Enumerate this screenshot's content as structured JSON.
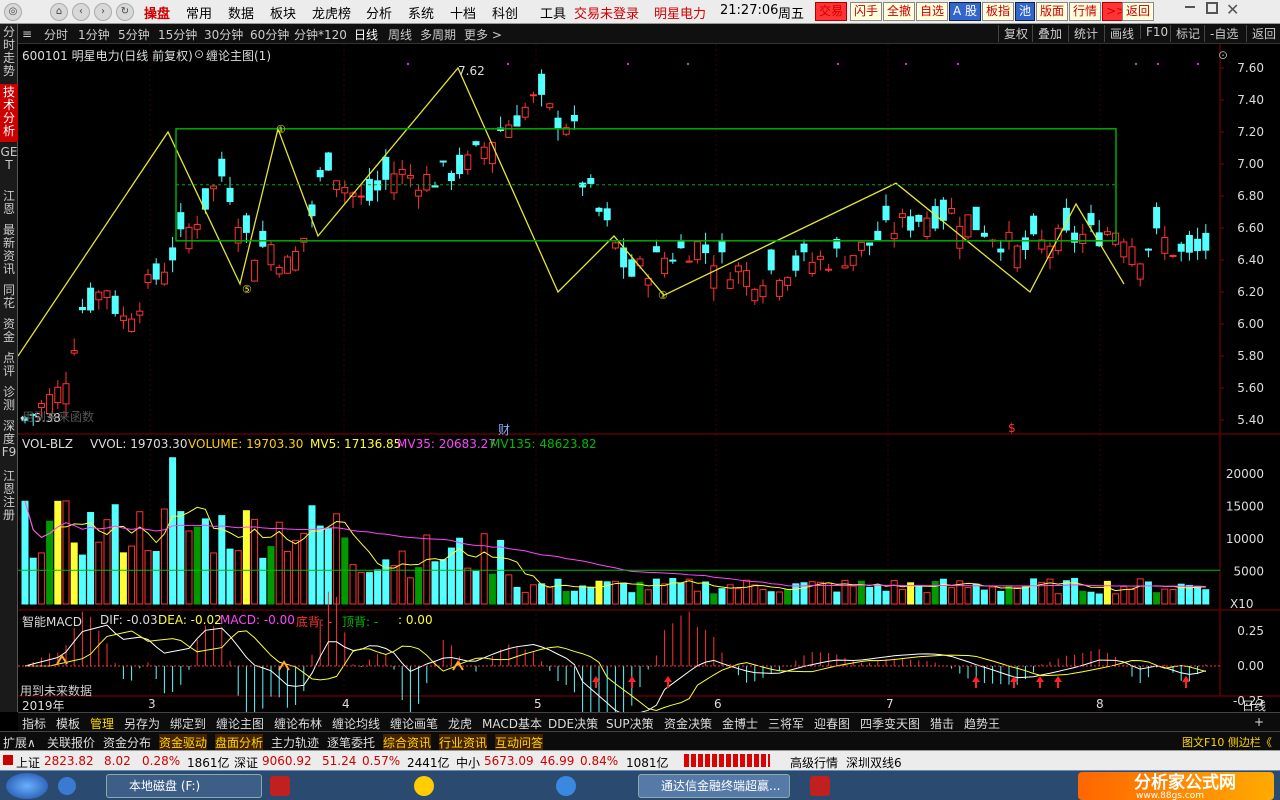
{
  "menu": {
    "brand": "操盘",
    "items": [
      "常用",
      "数据",
      "板块",
      "龙虎榜",
      "分析",
      "系统",
      "十档",
      "科创",
      "工具"
    ],
    "trade_status": "交易未登录",
    "stock_name": "明星电力",
    "time": "21:27:06",
    "weekday": "周五",
    "right_buttons": [
      "交易",
      "闪手",
      "全撤",
      "自选",
      "A 股",
      "板指",
      "池",
      "版面",
      "行情",
      ">>",
      "返回"
    ]
  },
  "side_tabs": [
    "分时走势",
    "技术分析",
    "GET",
    "江恩",
    "最新资讯",
    "同花",
    "资金",
    "点评",
    "诊测",
    "深度F9",
    "江恩注册"
  ],
  "periods": [
    "分时",
    "1分钟",
    "5分钟",
    "15分钟",
    "30分钟",
    "60分钟",
    "分钟*120",
    "日线",
    "周线",
    "多周期",
    "更多 >"
  ],
  "active_period": "日线",
  "right_tools": [
    "复权",
    "叠加",
    "统计",
    "画线",
    "F10",
    "标记",
    "-自选",
    "返回"
  ],
  "main_panel": {
    "title": "600101 明星电力(日线 前复权)",
    "indicator": "缠论主图(1)",
    "high_label": "7.62",
    "low_label": "5.38",
    "hidden_text": "用到未来函数",
    "cai_mark": "财",
    "s_mark": "$",
    "price_ticks": [
      "7.60",
      "7.40",
      "7.20",
      "7.00",
      "6.80",
      "6.60",
      "6.40",
      "6.20",
      "6.00",
      "5.80",
      "5.60",
      "5.40"
    ],
    "pivot_labels": [
      "①",
      "⑤",
      "①"
    ]
  },
  "volume_panel": {
    "label": "VOL-BLZ",
    "vvol": "VVOL: 19703.30",
    "volume": "VOLUME: 19703.30",
    "mv5": "MV5: 17136.85",
    "mv35": "MV35: 20683.27",
    "mv135": "MV135: 48623.82",
    "ticks": [
      "20000",
      "15000",
      "10000",
      "5000"
    ],
    "unit": "X10"
  },
  "macd_panel": {
    "name": "智能MACD",
    "dif": "DIF: -0.03",
    "dea": "DEA: -0.02",
    "macd": "MACD: -0.00",
    "bottom_div": "底背: -",
    "top_div": "顶背: -",
    "value": ": 0.00",
    "ticks": [
      "0.25",
      "0.00",
      "-0.25"
    ],
    "future_note": "用到未来数据"
  },
  "x_axis": {
    "labels": [
      "2019年",
      "3",
      "4",
      "5",
      "6",
      "7",
      "8"
    ],
    "corner": "日线"
  },
  "tab_row1": [
    "指标",
    "模板",
    "管理",
    "另存为",
    "绑定到",
    "缠论主图",
    "缠论布林",
    "缠论均线",
    "缠论画笔",
    "龙虎",
    "MACD基本",
    "DDE决策",
    "SUP决策",
    "资金决策",
    "金博士",
    "三将军",
    "迎春图",
    "四季变天图",
    "猎击",
    "趋势王"
  ],
  "tab_row1_active": "管理",
  "tab_row2": [
    "扩展∧",
    "关联报价",
    "资金分布",
    "资金驱动",
    "盘面分析",
    "主力轨迹",
    "逐笔委托",
    "综合资讯",
    "行业资讯",
    "互动问答"
  ],
  "tab_row2_right": "图文F10 侧边栏《",
  "status": {
    "sh_label": "上证",
    "sh_value": "2823.82",
    "sh_change": "8.02",
    "sh_pct": "0.28%",
    "sh_amount": "1861亿",
    "sz_label": "深证",
    "sz_value": "9060.92",
    "sz_change": "51.24",
    "sz_pct": "0.57%",
    "sz_amount": "2441亿",
    "zx_label": "中小",
    "zx_value": "5673.09",
    "zx_change": "46.99",
    "zx_pct": "0.84%",
    "zx_amount": "1081亿",
    "feed": "高级行情",
    "line": "深圳双线6"
  },
  "taskbar": {
    "disk": "本地磁盘 (F:)",
    "app": "通达信金融终端超赢...",
    "watermark": "分析家公式网",
    "watermark_url": "www.88gs.com"
  },
  "colors": {
    "up": "#ff3333",
    "down": "#54ffff",
    "yellow_bar": "#ffff33",
    "green_bar": "#009900",
    "zigzag": "#e6e62e",
    "box": "#00aa00"
  }
}
